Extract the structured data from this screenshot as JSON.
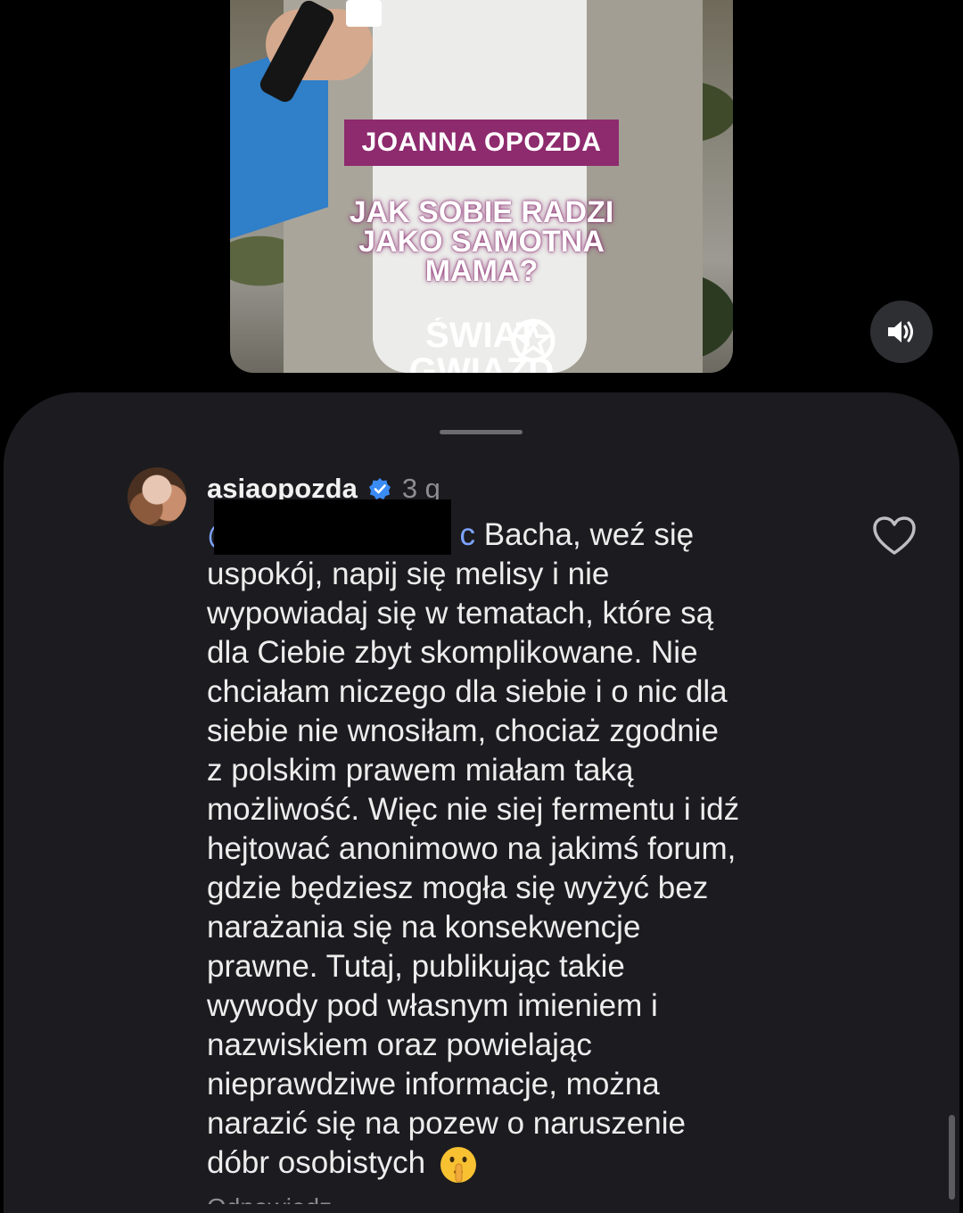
{
  "video": {
    "name_banner": "JOANNA OPOZDA",
    "headline": [
      "JAK SOBIE RADZI",
      "JAKO SAMOTNA",
      "MAMA?"
    ],
    "brand_lines": [
      "ŚWIAT",
      "GWIAZD"
    ],
    "banner_color": "#8e2a6e",
    "sound_icon": "speaker-on-icon"
  },
  "comment": {
    "username": "asiaopozda",
    "verified": true,
    "time": "3 g",
    "mention_visible": "@",
    "mention_tail": "c",
    "text_lines": [
      " Bacha, weź się",
      "uspokój, napij się melisy i nie",
      "wypowiadaj się w tematach, które są",
      "dla Ciebie zbyt skomplikowane. Nie",
      "chciałam niczego dla siebie i o nic dla",
      "siebie nie wnosiłam, chociaż zgodnie",
      "z polskim prawem miałam taką",
      "możliwość. Więc nie siej fermentu i idź",
      "hejtować anonimowo na jakimś forum,",
      "gdzie będziesz mogła się wyżyć bez",
      "narażania się na konsekwencje",
      "prawne. Tutaj, publikując takie",
      "wywody pod własnym imieniem i",
      "nazwiskiem oraz powielając",
      "nieprawdziwe informacje, można",
      "narazić się na pozew o naruszenie",
      "dóbr osobistych"
    ],
    "emoji": "shushing-face-icon",
    "mention_color": "#7da4ff",
    "like_icon": "heart-outline-icon",
    "reply_peek": "Odpowiedz"
  }
}
